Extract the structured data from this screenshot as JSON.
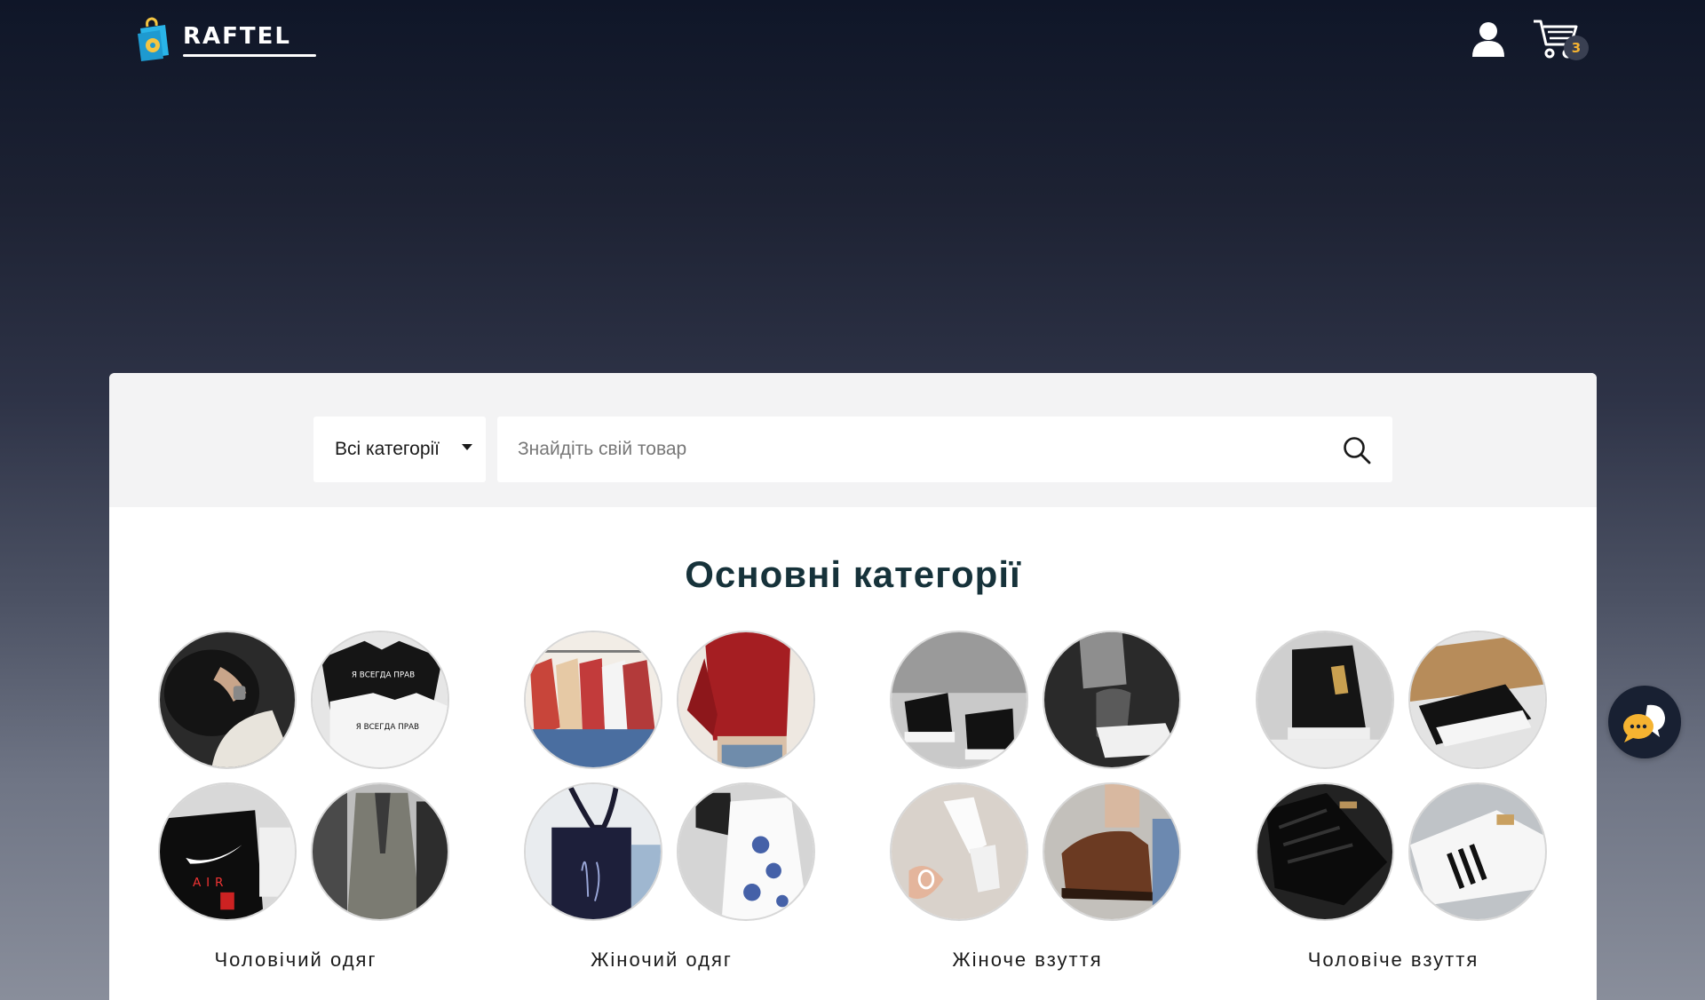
{
  "header": {
    "brand": "RAFTEL",
    "cart_count": "3",
    "icons": {
      "logo": "raftel-logo",
      "user": "user-icon",
      "cart": "cart-icon"
    }
  },
  "search": {
    "category_select_label": "Всі категорії",
    "placeholder": "Знайдіть свій товар",
    "value": "",
    "button_icon": "search-icon"
  },
  "main": {
    "section_title": "Основні категорії",
    "categories": [
      {
        "label": "Чоловічий одяг"
      },
      {
        "label": "Жіночий одяг"
      },
      {
        "label": "Жіноче взуття"
      },
      {
        "label": "Чоловіче взуття"
      }
    ]
  },
  "chat": {
    "icon": "chat-icon"
  },
  "colors": {
    "header_bg": "#0f1628",
    "card_bg": "#ffffff",
    "search_band_bg": "#f3f3f4",
    "title_color": "#16323a",
    "cart_badge_bg": "#3a4052",
    "cart_badge_text": "#f5b331",
    "chat_bg": "#182032"
  }
}
